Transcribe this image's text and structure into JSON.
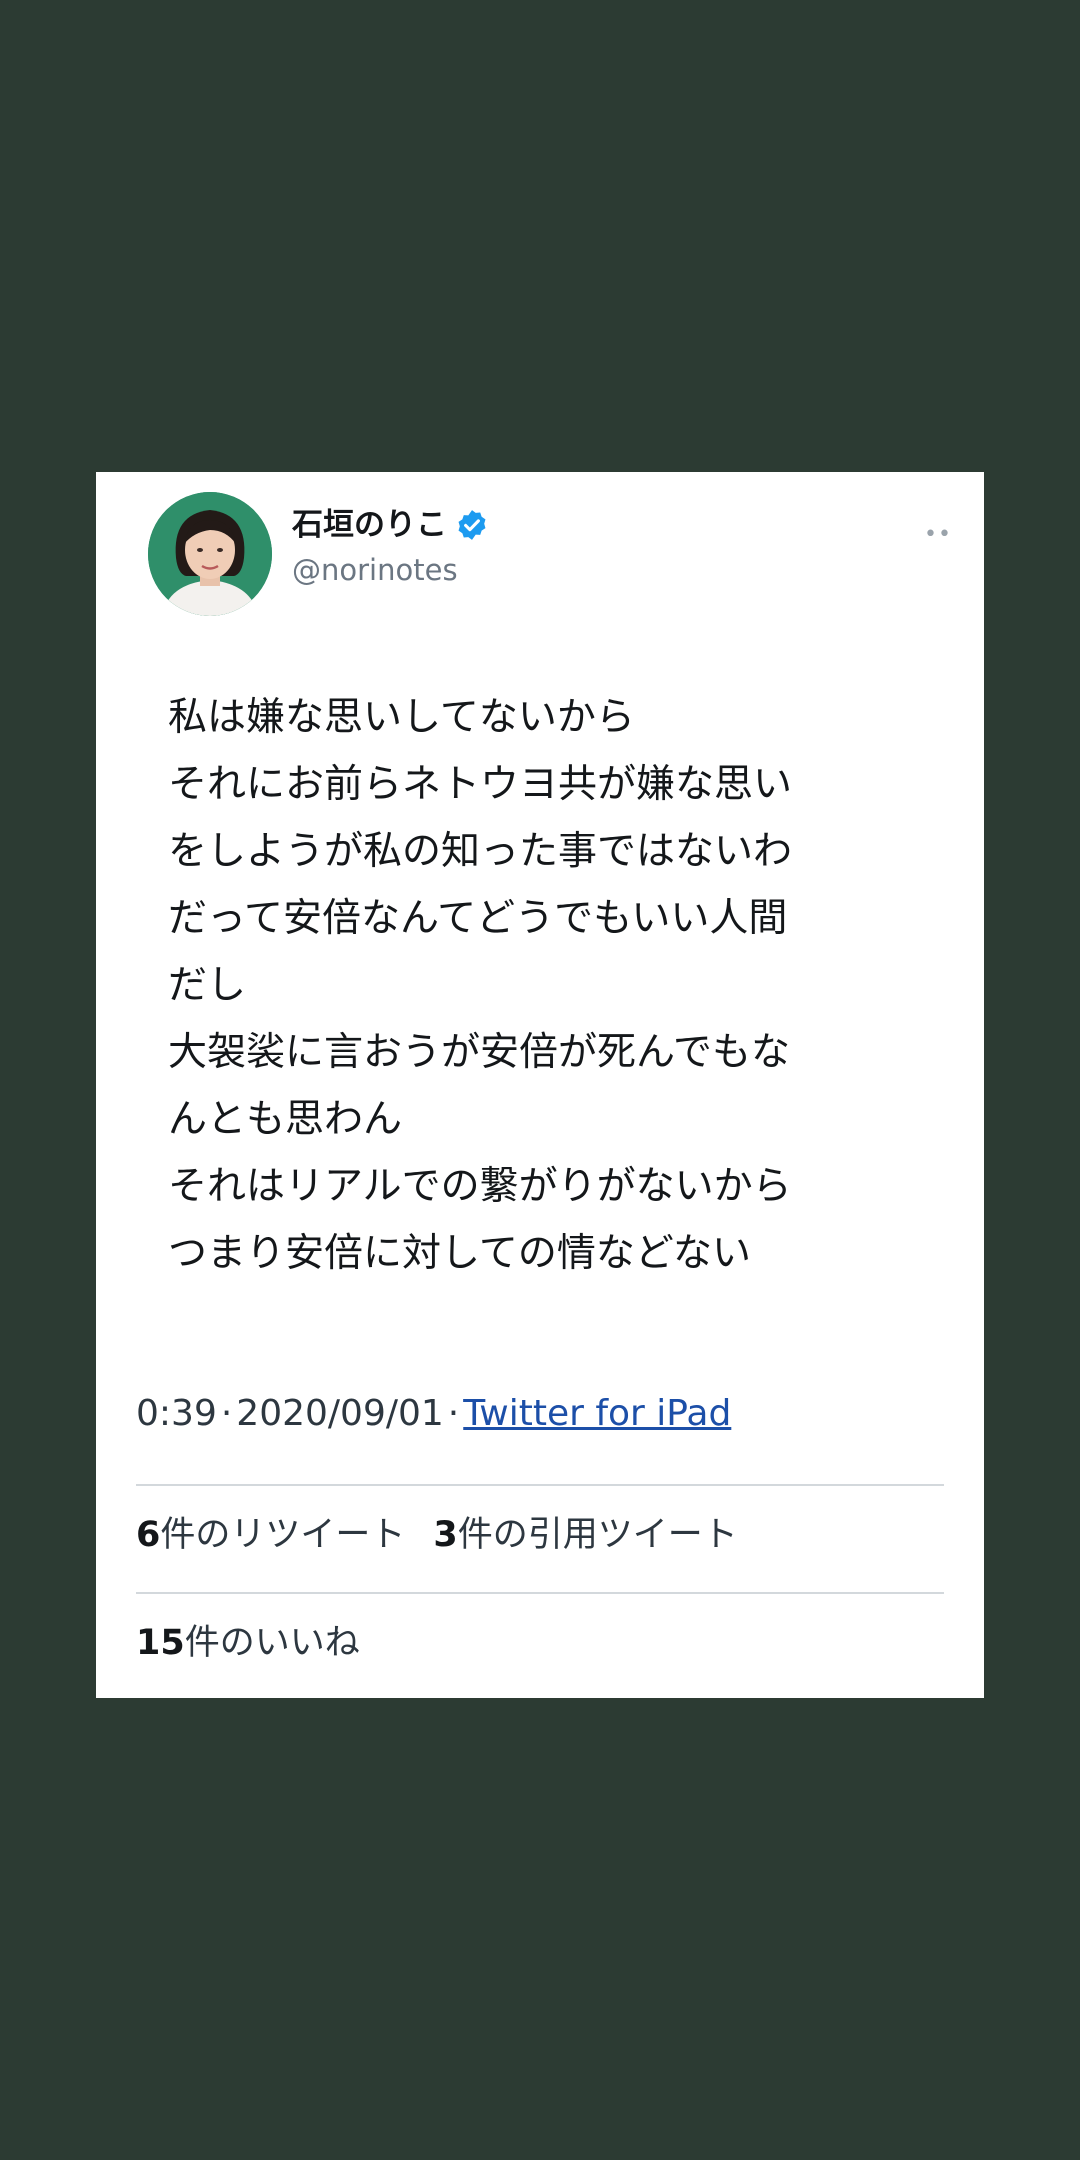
{
  "tweet": {
    "display_name": "石垣のりこ",
    "handle": "@norinotes",
    "more_icon": "••",
    "lines": [
      "私は嫌な思いしてないから",
      "それにお前らネトウヨ共が嫌な思い",
      "をしようが私の知った事ではないわ",
      "だって安倍なんてどうでもいい人間",
      "だし",
      "大袈裟に言おうが安倍が死んでもな",
      "んとも思わん",
      "それはリアルでの繋がりがないから",
      "つまり安倍に対しての情などない"
    ],
    "time": "0:39",
    "date": "2020/09/01",
    "source": "Twitter for iPad",
    "separator": "·"
  },
  "stats": {
    "retweets_count": "6",
    "retweets_label": "件のリツイート",
    "quotes_count": "3",
    "quotes_label": "件の引用ツイート",
    "likes_count": "15",
    "likes_label": "件のいいね"
  },
  "icons": {
    "verified": "verified-badge-icon",
    "more": "more-options-icon"
  },
  "colors": {
    "background": "#2c3b33",
    "card": "#ffffff",
    "verified_blue": "#1d9bf0",
    "link": "#1c4fa8"
  }
}
